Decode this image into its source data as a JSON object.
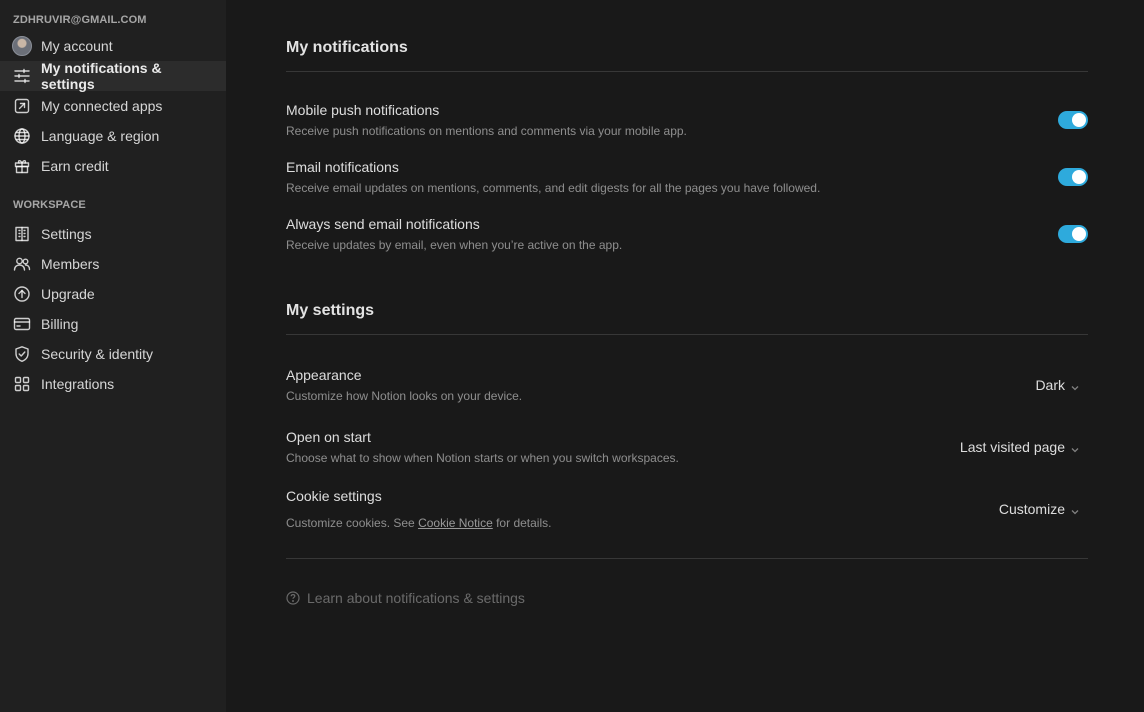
{
  "sidebar": {
    "account_email": "ZDHRUVIR@GMAIL.COM",
    "account_items": [
      {
        "label": "My account",
        "icon": "avatar"
      },
      {
        "label": "My notifications & settings",
        "icon": "sliders-icon",
        "active": true
      },
      {
        "label": "My connected apps",
        "icon": "external-link-icon"
      },
      {
        "label": "Language & region",
        "icon": "globe-icon"
      },
      {
        "label": "Earn credit",
        "icon": "gift-icon"
      }
    ],
    "workspace_label": "WORKSPACE",
    "workspace_items": [
      {
        "label": "Settings",
        "icon": "building-icon"
      },
      {
        "label": "Members",
        "icon": "people-icon"
      },
      {
        "label": "Upgrade",
        "icon": "arrow-up-circle-icon"
      },
      {
        "label": "Billing",
        "icon": "credit-card-icon"
      },
      {
        "label": "Security & identity",
        "icon": "shield-check-icon"
      },
      {
        "label": "Integrations",
        "icon": "grid-icon"
      }
    ]
  },
  "notifications": {
    "title": "My notifications",
    "items": [
      {
        "title": "Mobile push notifications",
        "description": "Receive push notifications on mentions and comments via your mobile app.",
        "enabled": true
      },
      {
        "title": "Email notifications",
        "description": "Receive email updates on mentions, comments, and edit digests for all the pages you have followed.",
        "enabled": true
      },
      {
        "title": "Always send email notifications",
        "description": "Receive updates by email, even when you’re active on the app.",
        "enabled": true
      }
    ]
  },
  "settings": {
    "title": "My settings",
    "appearance": {
      "title": "Appearance",
      "description": "Customize how Notion looks on your device.",
      "value": "Dark"
    },
    "open_on_start": {
      "title": "Open on start",
      "description": "Choose what to show when Notion starts or when you switch workspaces.",
      "value": "Last visited page"
    },
    "cookie": {
      "title": "Cookie settings",
      "description_prefix": "Customize cookies. See ",
      "link": "Cookie Notice",
      "description_suffix": " for details.",
      "value": "Customize"
    }
  },
  "help": {
    "label": "Learn about notifications & settings",
    "icon": "question-circle-icon"
  },
  "colors": {
    "toggle_on": "#2eaadc",
    "background": "#191919",
    "sidebar": "#202020"
  }
}
